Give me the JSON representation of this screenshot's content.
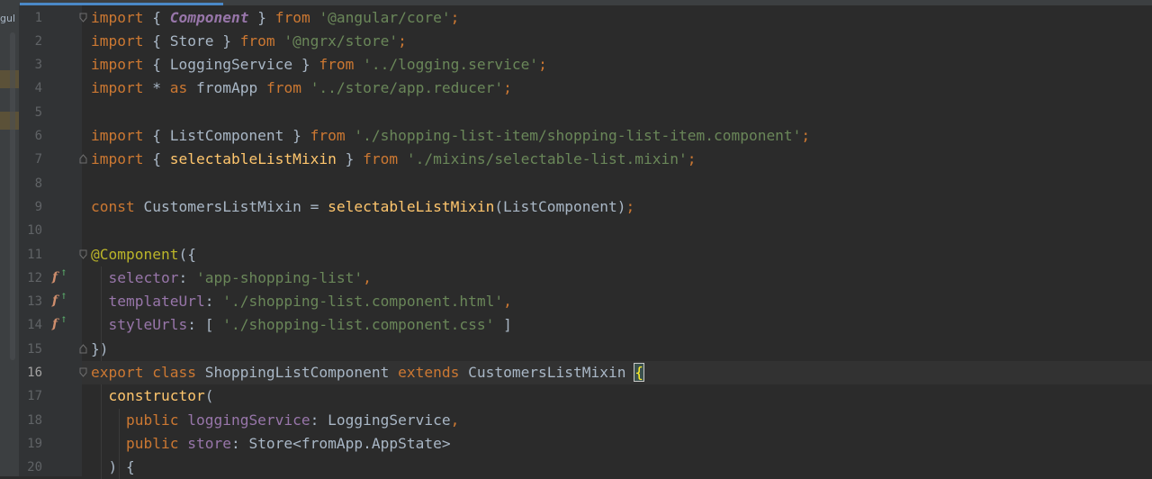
{
  "left_panel": {
    "label": "gul"
  },
  "lines": [
    {
      "n": "1",
      "tokens": [
        [
          "kw",
          "import"
        ],
        [
          "plain",
          " { "
        ],
        [
          "cls",
          "Component"
        ],
        [
          "plain",
          " } "
        ],
        [
          "kw",
          "from"
        ],
        [
          "plain",
          " "
        ],
        [
          "str",
          "'@angular/core'"
        ],
        [
          "kw",
          ";"
        ]
      ]
    },
    {
      "n": "2",
      "tokens": [
        [
          "kw",
          "import"
        ],
        [
          "plain",
          " { Store } "
        ],
        [
          "kw",
          "from"
        ],
        [
          "plain",
          " "
        ],
        [
          "str",
          "'@ngrx/store'"
        ],
        [
          "kw",
          ";"
        ]
      ]
    },
    {
      "n": "3",
      "tokens": [
        [
          "kw",
          "import"
        ],
        [
          "plain",
          " { LoggingService } "
        ],
        [
          "kw",
          "from"
        ],
        [
          "plain",
          " "
        ],
        [
          "str",
          "'../logging.service'"
        ],
        [
          "kw",
          ";"
        ]
      ]
    },
    {
      "n": "4",
      "tokens": [
        [
          "kw",
          "import"
        ],
        [
          "plain",
          " * "
        ],
        [
          "kw",
          "as"
        ],
        [
          "plain",
          " fromApp "
        ],
        [
          "kw",
          "from"
        ],
        [
          "plain",
          " "
        ],
        [
          "str",
          "'../store/app.reducer'"
        ],
        [
          "kw",
          ";"
        ]
      ]
    },
    {
      "n": "5",
      "tokens": []
    },
    {
      "n": "6",
      "tokens": [
        [
          "kw",
          "import"
        ],
        [
          "plain",
          " { ListComponent } "
        ],
        [
          "kw",
          "from"
        ],
        [
          "plain",
          " "
        ],
        [
          "str",
          "'./shopping-list-item/shopping-list-item.component'"
        ],
        [
          "kw",
          ";"
        ]
      ]
    },
    {
      "n": "7",
      "tokens": [
        [
          "kw",
          "import"
        ],
        [
          "plain",
          " { "
        ],
        [
          "fn",
          "selectableListMixin"
        ],
        [
          "plain",
          " } "
        ],
        [
          "kw",
          "from"
        ],
        [
          "plain",
          " "
        ],
        [
          "str",
          "'./mixins/selectable-list.mixin'"
        ],
        [
          "kw",
          ";"
        ]
      ]
    },
    {
      "n": "8",
      "tokens": []
    },
    {
      "n": "9",
      "tokens": [
        [
          "kw",
          "const"
        ],
        [
          "plain",
          " CustomersListMixin = "
        ],
        [
          "fn",
          "selectableListMixin"
        ],
        [
          "plain",
          "(ListComponent)"
        ],
        [
          "kw",
          ";"
        ]
      ]
    },
    {
      "n": "10",
      "tokens": []
    },
    {
      "n": "11",
      "tokens": [
        [
          "anno",
          "@Component"
        ],
        [
          "plain",
          "({"
        ]
      ]
    },
    {
      "n": "12",
      "tokens": [
        [
          "plain",
          "  "
        ],
        [
          "prop",
          "selector"
        ],
        [
          "plain",
          ": "
        ],
        [
          "str",
          "'app-shopping-list'"
        ],
        [
          "kw",
          ","
        ]
      ]
    },
    {
      "n": "13",
      "tokens": [
        [
          "plain",
          "  "
        ],
        [
          "prop",
          "templateUrl"
        ],
        [
          "plain",
          ": "
        ],
        [
          "str",
          "'./shopping-list.component.html'"
        ],
        [
          "kw",
          ","
        ]
      ]
    },
    {
      "n": "14",
      "tokens": [
        [
          "plain",
          "  "
        ],
        [
          "prop",
          "styleUrls"
        ],
        [
          "plain",
          ": [ "
        ],
        [
          "str",
          "'./shopping-list.component.css'"
        ],
        [
          "plain",
          " ]"
        ]
      ]
    },
    {
      "n": "15",
      "tokens": [
        [
          "plain",
          "})"
        ]
      ]
    },
    {
      "n": "16",
      "tokens": [
        [
          "kw",
          "export class"
        ],
        [
          "plain",
          " ShoppingListComponent "
        ],
        [
          "kw",
          "extends"
        ],
        [
          "plain",
          " CustomersListMixin "
        ],
        [
          "caret-brace",
          "{"
        ]
      ]
    },
    {
      "n": "17",
      "tokens": [
        [
          "plain",
          "  "
        ],
        [
          "fn",
          "constructor"
        ],
        [
          "plain",
          "("
        ]
      ]
    },
    {
      "n": "18",
      "tokens": [
        [
          "plain",
          "    "
        ],
        [
          "kw",
          "public"
        ],
        [
          "plain",
          " "
        ],
        [
          "prop",
          "loggingService"
        ],
        [
          "plain",
          ": LoggingService"
        ],
        [
          "kw",
          ","
        ]
      ]
    },
    {
      "n": "19",
      "tokens": [
        [
          "plain",
          "    "
        ],
        [
          "kw",
          "public"
        ],
        [
          "plain",
          " "
        ],
        [
          "prop",
          "store"
        ],
        [
          "plain",
          ": Store<fromApp.AppState>"
        ]
      ]
    },
    {
      "n": "20",
      "tokens": [
        [
          "plain",
          "  ) {"
        ]
      ]
    }
  ],
  "gutter_icons": {
    "12": "fx",
    "13": "fx",
    "14": "fx"
  },
  "fold_markers": [
    "1",
    "7",
    "11",
    "15",
    "16"
  ],
  "current_line": "16",
  "colors": {
    "background": "#2b2b2b",
    "gutter": "#313335",
    "keyword": "#cc7832",
    "string": "#6a8759",
    "function": "#ffc66d",
    "annotation": "#bbb529",
    "property": "#9876aa",
    "text": "#a9b7c6"
  }
}
